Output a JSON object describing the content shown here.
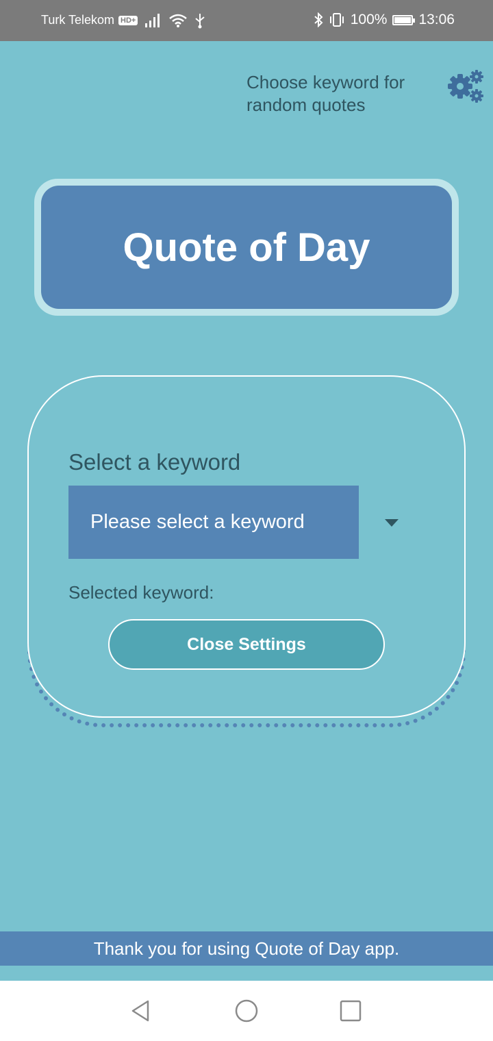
{
  "status_bar": {
    "carrier": "Turk Telekom",
    "hd_badge": "HD+",
    "battery": "100%",
    "battery_level": 1.0,
    "time": "13:06",
    "icons": [
      "signal-icon",
      "wifi-icon",
      "usb-icon",
      "bluetooth-icon",
      "vibrate-icon",
      "battery-icon"
    ]
  },
  "header": {
    "settings_hint": "Choose keyword for random quotes",
    "settings_icon": "gear-icon"
  },
  "title_card": {
    "title": "Quote of Day"
  },
  "settings_panel": {
    "select_label": "Select a keyword",
    "dropdown_value": "Please select a keyword",
    "selected_label": "Selected keyword:",
    "close_button": "Close Settings"
  },
  "footer": {
    "message": "Thank you for using Quote of Day app."
  },
  "colors": {
    "background": "#79c2cf",
    "primary": "#5585b5",
    "button": "#51a6b4",
    "text_dark": "#2f5560"
  },
  "nav_bar": {
    "icons": [
      "back-icon",
      "home-icon",
      "recents-icon"
    ]
  }
}
